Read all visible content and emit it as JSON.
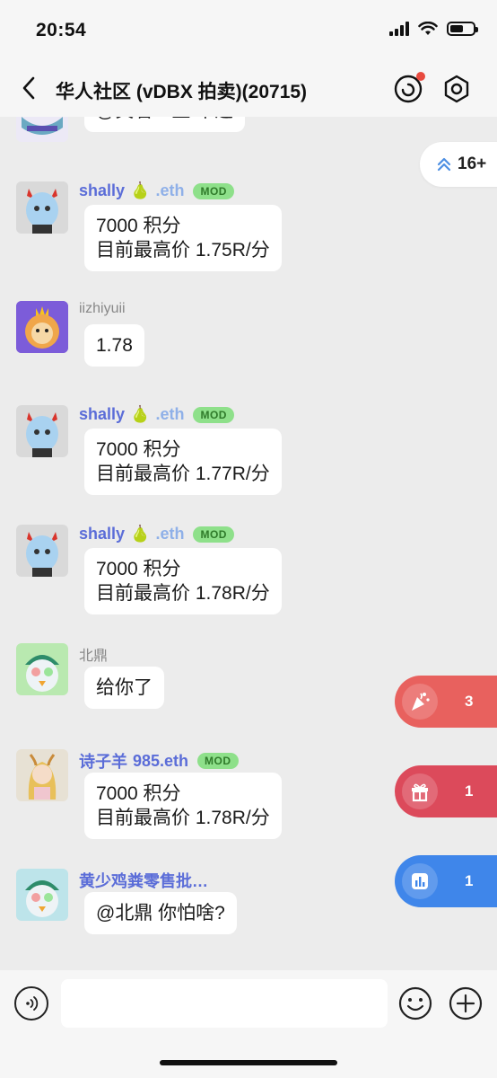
{
  "status_bar": {
    "time": "20:54"
  },
  "header": {
    "title": "华人社区 (vDBX 拍卖)(20715)"
  },
  "unread_pill": {
    "label": "16+"
  },
  "messages": [
    {
      "text": "@笑看一生 牛逼"
    },
    {
      "name": "shally",
      "emoji": "🍐",
      "name_suffix": ".eth",
      "badge": "MOD",
      "text": "7000 积分\n目前最高价 1.75R/分"
    },
    {
      "name": "iizhiyuii",
      "text": "1.78"
    },
    {
      "name": "shally",
      "emoji": "🍐",
      "name_suffix": ".eth",
      "badge": "MOD",
      "text": "7000 积分\n目前最高价 1.77R/分"
    },
    {
      "name": "shally",
      "emoji": "🍐",
      "name_suffix": ".eth",
      "badge": "MOD",
      "text": "7000 积分\n目前最高价 1.78R/分"
    },
    {
      "name": "北鼎",
      "text": "给你了"
    },
    {
      "name": "诗子羊",
      "name_suffix": " 985.eth",
      "badge": "MOD",
      "text": "7000 积分\n目前最高价 1.78R/分"
    },
    {
      "name": "黄少鸡粪零售批…",
      "text": "@北鼎 你怕啥?"
    }
  ],
  "floating_buttons": [
    {
      "icon": "party-popper-icon",
      "count": "3",
      "color": "#e8615e"
    },
    {
      "icon": "gift-icon",
      "count": "1",
      "color": "#dc4a5b"
    },
    {
      "icon": "chart-icon",
      "count": "1",
      "color": "#3f86ea"
    }
  ],
  "input_bar": {
    "placeholder": ""
  }
}
